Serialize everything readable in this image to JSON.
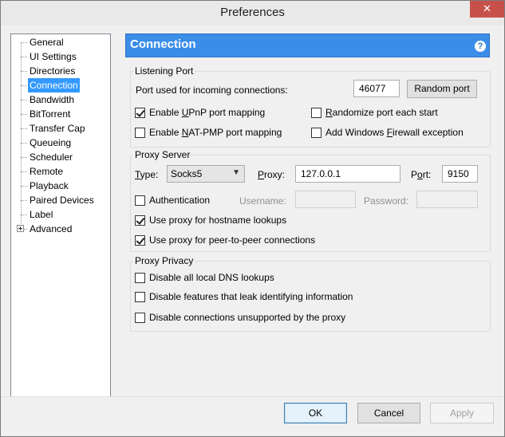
{
  "window": {
    "title": "Preferences",
    "close": "✕"
  },
  "tree": {
    "items": [
      {
        "label": "General"
      },
      {
        "label": "UI Settings"
      },
      {
        "label": "Directories"
      },
      {
        "label": "Connection"
      },
      {
        "label": "Bandwidth"
      },
      {
        "label": "BitTorrent"
      },
      {
        "label": "Transfer Cap"
      },
      {
        "label": "Queueing"
      },
      {
        "label": "Scheduler"
      },
      {
        "label": "Remote"
      },
      {
        "label": "Playback"
      },
      {
        "label": "Paired Devices"
      },
      {
        "label": "Label"
      },
      {
        "label": "Advanced"
      }
    ],
    "selected": "Connection"
  },
  "header": {
    "title": "Connection",
    "help": "?"
  },
  "listening_port": {
    "group_label": "Listening Port",
    "port_label": "Port used for incoming connections:",
    "port_value": "46077",
    "random_port": "Random port",
    "upnp": {
      "pre": "Enable ",
      "key": "U",
      "post": "PnP port mapping",
      "checked": true
    },
    "natpmp": {
      "pre": "Enable ",
      "key": "N",
      "post": "AT-PMP port mapping",
      "checked": false
    },
    "randomize": {
      "pre": "",
      "key": "R",
      "post": "andomize port each start",
      "checked": false
    },
    "firewall": {
      "pre": "Add Windows ",
      "key": "F",
      "post": "irewall exception",
      "checked": false
    }
  },
  "proxy_server": {
    "group_label": "Proxy Server",
    "type_label_key": "T",
    "type_label_rest": "ype:",
    "type_value": "Socks5",
    "proxy_label_key": "P",
    "proxy_label_rest": "roxy:",
    "proxy_value": "127.0.0.1",
    "port_label_pre": "P",
    "port_label_key": "o",
    "port_label_rest": "rt:",
    "port_value": "9150",
    "auth_label": "Authentication",
    "auth_checked": false,
    "username_label": "Username:",
    "password_label": "Password:",
    "hostname_lookups": "Use proxy for hostname lookups",
    "hostname_checked": true,
    "p2p": "Use proxy for peer-to-peer connections",
    "p2p_checked": true
  },
  "proxy_privacy": {
    "group_label": "Proxy Privacy",
    "dns": "Disable all local DNS lookups",
    "leak": "Disable features that leak identifying information",
    "unsupported": "Disable connections unsupported by the proxy"
  },
  "footer": {
    "ok": "OK",
    "cancel": "Cancel",
    "apply": "Apply"
  }
}
